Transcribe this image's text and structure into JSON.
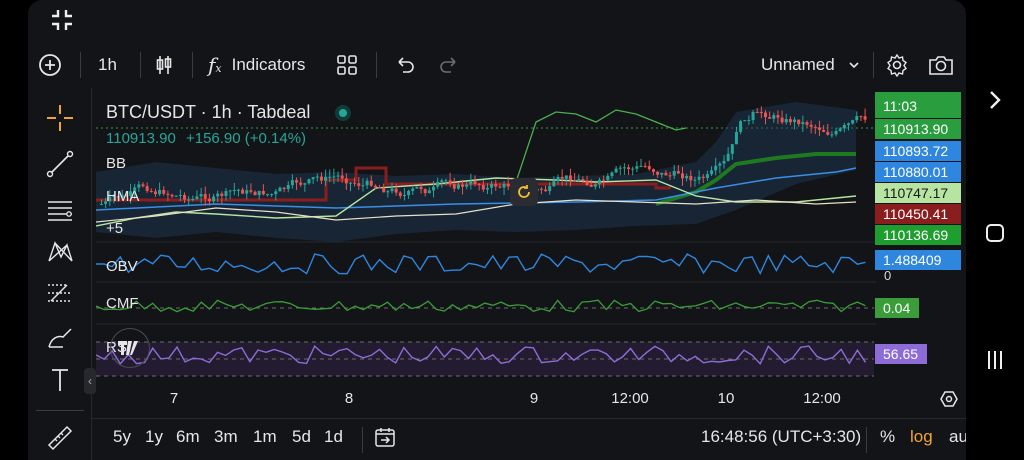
{
  "toolbar": {
    "interval": "1h",
    "indicators_label": "Indicators",
    "layout_name": "Unnamed"
  },
  "legend": {
    "title": "BTC/USDT · 1h · Tabdeal",
    "price": "110913.90",
    "change": "+156.90 (+0.14%)",
    "indicators": [
      "BB",
      "HMA",
      "+5"
    ]
  },
  "panes": {
    "obv": "OBV",
    "cmf": "CMF",
    "rsi": "RSI"
  },
  "price_scale": [
    {
      "text": "11:03",
      "bg": "#2a9d3f"
    },
    {
      "text": "110913.90",
      "bg": "#2a9d3f"
    },
    {
      "text": "110893.72",
      "bg": "#2e86de"
    },
    {
      "text": "110880.01",
      "bg": "#2e86de"
    },
    {
      "text": "110747.17",
      "bg": "#b7e4a0"
    },
    {
      "text": "110450.41",
      "bg": "#8a1e1e"
    },
    {
      "text": "110136.69",
      "bg": "#1e9e2e"
    }
  ],
  "indicator_values": {
    "obv": "1.488409",
    "obv_zero": "0",
    "cmf": "0.04",
    "rsi": "56.65"
  },
  "time_axis": [
    "7",
    "8",
    "9",
    "12:00",
    "10",
    "12:00"
  ],
  "ranges": [
    "5y",
    "1y",
    "6m",
    "3m",
    "1m",
    "5d",
    "1d"
  ],
  "status": {
    "clock": "16:48:56 (UTC+3:30)",
    "percent": "%",
    "log": "log",
    "auto": "auto"
  },
  "colors": {
    "accent_orange": "#f0a531",
    "up": "#26a69a",
    "down": "#ef5350",
    "hma_green": "#1f7a1f",
    "rsi_purple": "#8e6cd8"
  }
}
